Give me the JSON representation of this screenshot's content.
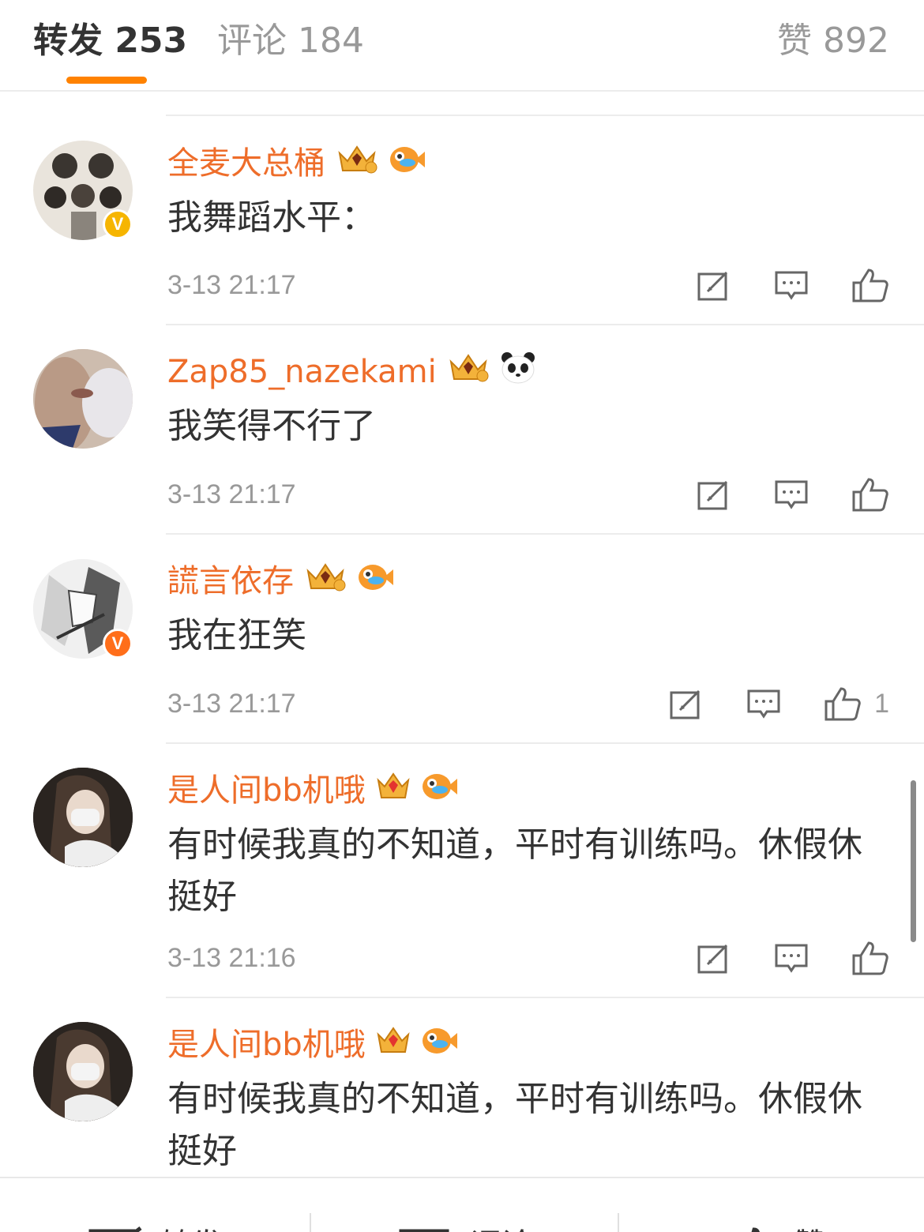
{
  "header": {
    "tabs": [
      {
        "label": "转发 253"
      },
      {
        "label": "评论 184"
      },
      {
        "label": "赞 892"
      }
    ]
  },
  "comments": [
    {
      "username": "全麦大总桶",
      "text": "我舞蹈水平：",
      "time": "3-13 21:17",
      "likes": "",
      "verified_color": "#f6b500"
    },
    {
      "username": "Zap85_nazekami",
      "text": "我笑得不行了",
      "time": "3-13 21:17",
      "likes": ""
    },
    {
      "username": "謊言依存",
      "text": "我在狂笑",
      "time": "3-13 21:17",
      "likes": "1",
      "verified_color": "#ff6e1a"
    },
    {
      "username": "是人间bb机哦",
      "text": "有时候我真的不知道，平时有训练吗。休假休挺好",
      "time": "3-13 21:16",
      "likes": ""
    },
    {
      "username": "是人间bb机哦",
      "text": "有时候我真的不知道，平时有训练吗。休假休挺好",
      "time": "",
      "likes": ""
    }
  ],
  "bottom_bar": {
    "repost_label": "转发",
    "comment_label": "评论",
    "like_label": "赞"
  },
  "colors": {
    "accent": "#ff8200",
    "username": "#ee6d2a"
  },
  "icons": [
    "repost-icon",
    "comment-icon",
    "like-icon",
    "crown-badge-icon",
    "fish-badge-icon",
    "panda-badge-icon",
    "verified-icon"
  ]
}
